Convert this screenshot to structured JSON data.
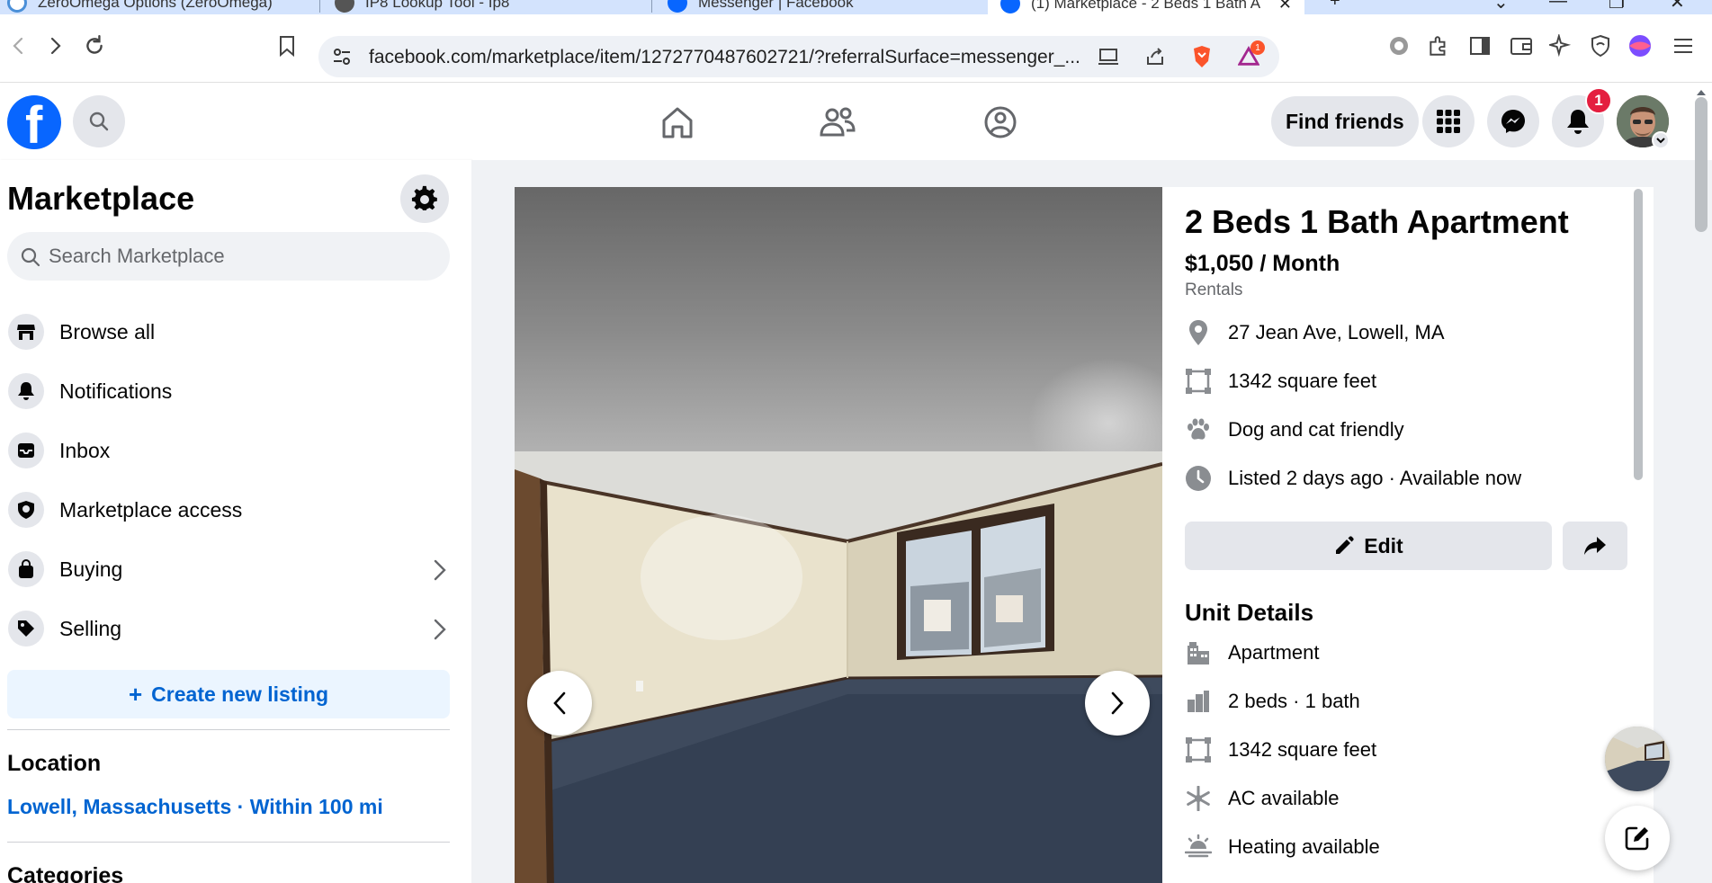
{
  "browser": {
    "tabs": [
      {
        "label": "ZeroOmega Options (ZeroOmega)",
        "active": false
      },
      {
        "label": "IP8 Lookup Tool - Ip8",
        "active": false
      },
      {
        "label": "Messenger | Facebook",
        "active": false
      },
      {
        "label": "(1) Marketplace - 2 Beds 1 Bath A",
        "active": true
      }
    ],
    "url": "facebook.com/marketplace/item/1272770487602721/?referralSurface=messenger_...",
    "extension_badge": "1"
  },
  "header": {
    "logo_letter": "f",
    "find_friends": "Find friends",
    "notification_count": "1"
  },
  "sidebar": {
    "title": "Marketplace",
    "search_placeholder": "Search Marketplace",
    "items": [
      {
        "label": "Browse all",
        "icon": "storefront-icon"
      },
      {
        "label": "Notifications",
        "icon": "bell-icon"
      },
      {
        "label": "Inbox",
        "icon": "inbox-icon"
      },
      {
        "label": "Marketplace access",
        "icon": "shield-icon"
      },
      {
        "label": "Buying",
        "icon": "shopping-bag-icon"
      },
      {
        "label": "Selling",
        "icon": "price-tag-icon"
      }
    ],
    "create_listing": "Create new listing",
    "location_heading": "Location",
    "location_value": "Lowell, Massachusetts · Within 100 mi",
    "categories_heading": "Categories"
  },
  "listing": {
    "title": "2 Beds 1 Bath Apartment",
    "price": "$1,050 / Month",
    "category": "Rentals",
    "facts": [
      {
        "icon": "location-pin-icon",
        "text": "27 Jean Ave, Lowell, MA"
      },
      {
        "icon": "square-footage-icon",
        "text": "1342 square feet"
      },
      {
        "icon": "paw-icon",
        "text": "Dog and cat friendly"
      },
      {
        "icon": "clock-icon",
        "text": "Listed 2 days ago · Available now"
      }
    ],
    "edit_label": "Edit",
    "unit_details_heading": "Unit Details",
    "unit_details": [
      {
        "icon": "building-icon",
        "text": "Apartment"
      },
      {
        "icon": "bed-icon",
        "text": "2 beds · 1 bath"
      },
      {
        "icon": "square-footage-icon",
        "text": "1342 square feet"
      },
      {
        "icon": "snowflake-icon",
        "text": "AC available"
      },
      {
        "icon": "heating-icon",
        "text": "Heating available"
      }
    ]
  },
  "colors": {
    "facebook_blue": "#0866ff",
    "link_blue": "#0064d1",
    "badge_red": "#e41e3f",
    "page_background": "#f0f2f5"
  }
}
